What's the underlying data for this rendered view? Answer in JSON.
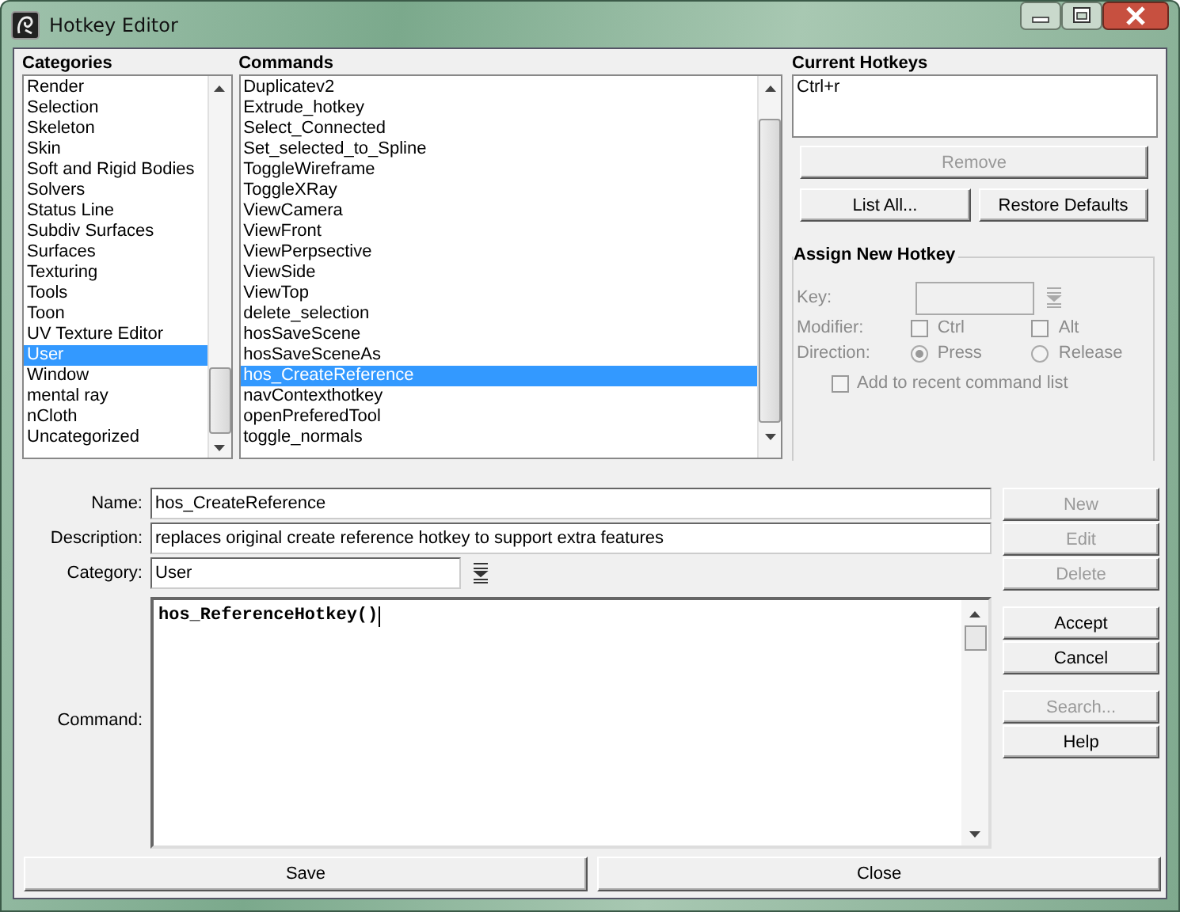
{
  "window": {
    "title": "Hotkey Editor"
  },
  "categories": {
    "label": "Categories",
    "items": [
      {
        "label": "Render",
        "selected": false
      },
      {
        "label": "Selection",
        "selected": false
      },
      {
        "label": "Skeleton",
        "selected": false
      },
      {
        "label": "Skin",
        "selected": false
      },
      {
        "label": "Soft and Rigid Bodies",
        "selected": false
      },
      {
        "label": "Solvers",
        "selected": false
      },
      {
        "label": "Status Line",
        "selected": false
      },
      {
        "label": "Subdiv Surfaces",
        "selected": false
      },
      {
        "label": "Surfaces",
        "selected": false
      },
      {
        "label": "Texturing",
        "selected": false
      },
      {
        "label": "Tools",
        "selected": false
      },
      {
        "label": "Toon",
        "selected": false
      },
      {
        "label": "UV Texture Editor",
        "selected": false
      },
      {
        "label": "User",
        "selected": true
      },
      {
        "label": "Window",
        "selected": false
      },
      {
        "label": "mental ray",
        "selected": false
      },
      {
        "label": "nCloth",
        "selected": false
      },
      {
        "label": "Uncategorized",
        "selected": false
      }
    ]
  },
  "commands": {
    "label": "Commands",
    "items": [
      {
        "label": "Duplicatev2",
        "selected": false
      },
      {
        "label": "Extrude_hotkey",
        "selected": false
      },
      {
        "label": "Select_Connected",
        "selected": false
      },
      {
        "label": "Set_selected_to_Spline",
        "selected": false
      },
      {
        "label": "ToggleWireframe",
        "selected": false
      },
      {
        "label": "ToggleXRay",
        "selected": false
      },
      {
        "label": "ViewCamera",
        "selected": false
      },
      {
        "label": "ViewFront",
        "selected": false
      },
      {
        "label": "ViewPerpsective",
        "selected": false
      },
      {
        "label": "ViewSide",
        "selected": false
      },
      {
        "label": "ViewTop",
        "selected": false
      },
      {
        "label": "delete_selection",
        "selected": false
      },
      {
        "label": "hosSaveScene",
        "selected": false
      },
      {
        "label": "hosSaveSceneAs",
        "selected": false
      },
      {
        "label": "hos_CreateReference",
        "selected": true
      },
      {
        "label": "navContexthotkey",
        "selected": false
      },
      {
        "label": "openPreferedTool",
        "selected": false
      },
      {
        "label": "toggle_normals",
        "selected": false
      }
    ]
  },
  "current_hotkeys": {
    "label": "Current Hotkeys",
    "items": [
      "Ctrl+r"
    ]
  },
  "hotkey_buttons": [
    {
      "label": "Remove",
      "disabled": true
    },
    {
      "label": "List All...",
      "disabled": false
    },
    {
      "label": "Restore Defaults",
      "disabled": false
    }
  ],
  "assign": {
    "title": "Assign New Hotkey",
    "disabled": true,
    "key": {
      "label": "Key:"
    },
    "modifier": {
      "label": "Modifier:",
      "options": [
        {
          "label": "Ctrl",
          "checked": false
        },
        {
          "label": "Alt",
          "checked": false
        }
      ]
    },
    "direction": {
      "label": "Direction:",
      "options": [
        {
          "label": "Press",
          "selected": true
        },
        {
          "label": "Release",
          "selected": false
        }
      ]
    },
    "add_recent": {
      "label": "Add to recent command list",
      "checked": false
    }
  },
  "form": {
    "name": {
      "label": "Name:",
      "value": "hos_CreateReference"
    },
    "description": {
      "label": "Description:",
      "value": "replaces original create reference hotkey to support extra features"
    },
    "category": {
      "label": "Category:",
      "value": "User"
    },
    "command": {
      "label": "Command:",
      "value": "hos_ReferenceHotkey()"
    }
  },
  "side_button_groups": [
    [
      {
        "label": "New",
        "disabled": true
      },
      {
        "label": "Edit",
        "disabled": true
      },
      {
        "label": "Delete",
        "disabled": true
      }
    ],
    [
      {
        "label": "Accept",
        "disabled": false
      },
      {
        "label": "Cancel",
        "disabled": false
      }
    ],
    [
      {
        "label": "Search...",
        "disabled": true
      },
      {
        "label": "Help",
        "disabled": false
      }
    ]
  ],
  "footer_buttons": [
    {
      "label": "Save"
    },
    {
      "label": "Close"
    }
  ]
}
